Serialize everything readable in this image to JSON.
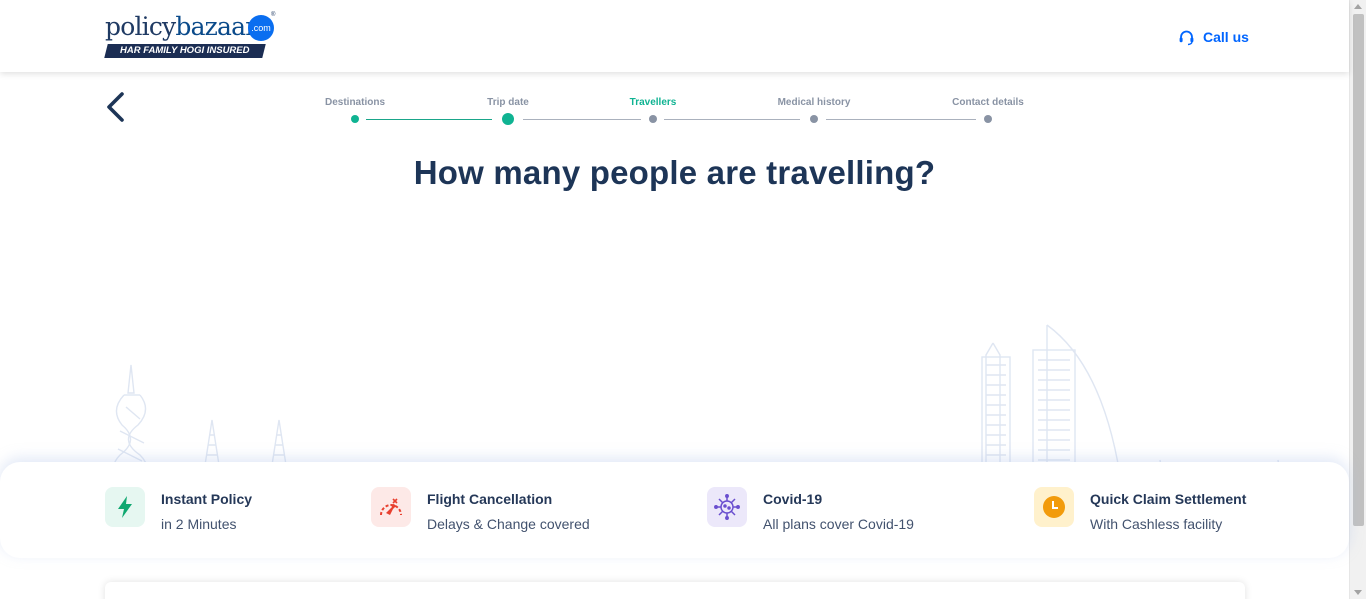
{
  "header": {
    "logo_word_a": "policy",
    "logo_word_b": "bazaar",
    "logo_dot": ".com",
    "logo_tm": "®",
    "tagline": "HAR FAMILY HOGI INSURED",
    "call_label": "Call us",
    "call_icon": "headset-icon"
  },
  "stepper": {
    "steps": [
      {
        "label": "Destinations",
        "state": "done"
      },
      {
        "label": "Trip date",
        "state": "done"
      },
      {
        "label": "Travellers",
        "state": "current"
      },
      {
        "label": "Medical history",
        "state": "pending"
      },
      {
        "label": "Contact details",
        "state": "pending"
      }
    ],
    "back_icon": "chevron-left-icon"
  },
  "main": {
    "heading": "How many people are travelling?"
  },
  "features": [
    {
      "title": "Instant Policy",
      "subtitle": "in 2 Minutes",
      "icon": "lightning-icon",
      "tint": "#e6f7f1",
      "color": "#0fa870"
    },
    {
      "title": "Flight Cancellation",
      "subtitle": "Delays & Change covered",
      "icon": "flight-cancel-icon",
      "tint": "#fde9e7",
      "color": "#e8402f"
    },
    {
      "title": "Covid-19",
      "subtitle": "All plans cover Covid-19",
      "icon": "virus-icon",
      "tint": "#ece8fa",
      "color": "#6a4fcf"
    },
    {
      "title": "Quick Claim Settlement",
      "subtitle": "With Cashless facility",
      "icon": "clock-icon",
      "tint": "#fff1cc",
      "color": "#f29b0b"
    }
  ],
  "colors": {
    "accent": "#0fb392",
    "brand_blue": "#0065ff",
    "heading": "#1d3557"
  }
}
